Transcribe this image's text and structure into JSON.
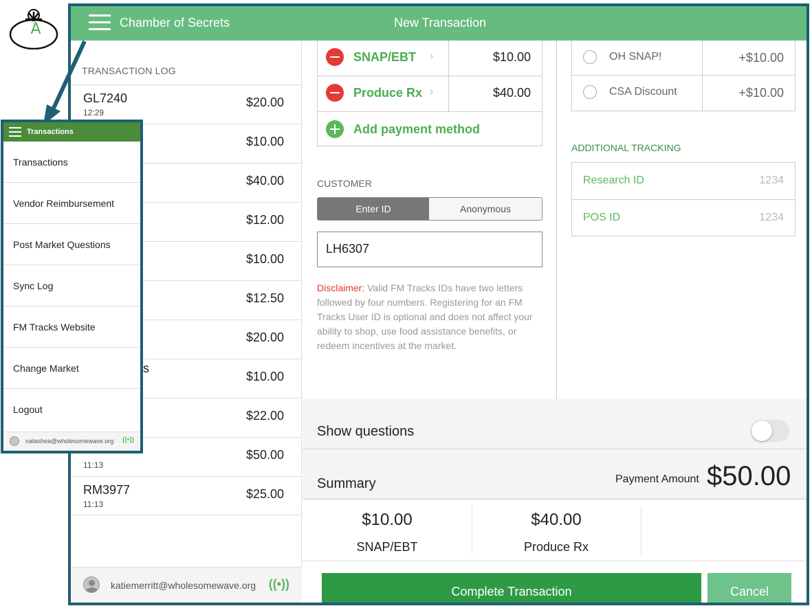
{
  "badge_letter": "A",
  "header": {
    "app_title": "Chamber of Secrets",
    "page_title": "New Transaction"
  },
  "log": {
    "heading": "TRANSACTION LOG",
    "rows": [
      {
        "id": "GL7240",
        "time": "12:29",
        "amount": "$20.00"
      },
      {
        "id": "",
        "time": "",
        "amount": "$10.00"
      },
      {
        "id": "",
        "time": "",
        "amount": "$40.00"
      },
      {
        "id": "",
        "time": "",
        "amount": "$12.00"
      },
      {
        "id": "",
        "time": "",
        "amount": "$10.00"
      },
      {
        "id": "",
        "time": "",
        "amount": "$12.50"
      },
      {
        "id": "",
        "time": "",
        "amount": "$20.00"
      },
      {
        "id": "",
        "time": "",
        "amount": "$10.00"
      },
      {
        "id": "",
        "time": "",
        "amount": "$22.00"
      },
      {
        "id": "",
        "time": "11:13",
        "amount": "$50.00"
      },
      {
        "id": "RM3977",
        "time": "11:13",
        "amount": "$25.00"
      }
    ],
    "partial_text": "s",
    "footer_email": "katiemerritt@wholesomewave.org",
    "wifi_icon": "((•))"
  },
  "payments": [
    {
      "name": "SNAP/EBT",
      "amount": "$10.00"
    },
    {
      "name": "Produce Rx",
      "amount": "$40.00"
    }
  ],
  "chevron": "›",
  "add_payment": "Add payment method",
  "customer": {
    "heading": "CUSTOMER",
    "seg_enter": "Enter ID",
    "seg_anon": "Anonymous",
    "id_value": "LH6307",
    "disclaimer_label": "Disclaimer:",
    "disclaimer_text": " Valid FM Tracks IDs have two letters followed by four numbers. Registering for an FM Tracks User ID is optional and does not affect your ability to shop, use food assistance benefits, or redeem incentives at the market."
  },
  "incentives": [
    {
      "name": "OH SNAP!",
      "amount": "+$10.00"
    },
    {
      "name": "CSA Discount",
      "amount": "+$10.00"
    }
  ],
  "tracking": {
    "heading": "ADDITIONAL TRACKING",
    "fields": [
      {
        "name": "Research ID",
        "placeholder": "1234"
      },
      {
        "name": "POS ID",
        "placeholder": "1234"
      }
    ]
  },
  "questions": {
    "label": "Show questions",
    "enabled": false
  },
  "summary": {
    "label": "Summary",
    "payment_amount_label": "Payment Amount",
    "payment_amount": "$50.00",
    "totals": [
      {
        "value": "$10.00",
        "name": "SNAP/EBT"
      },
      {
        "value": "$40.00",
        "name": "Produce Rx"
      }
    ]
  },
  "buttons": {
    "complete": "Complete Transaction",
    "cancel": "Cancel"
  },
  "menu": {
    "title": "Transactions",
    "items": [
      "Transactions",
      "Vendor Reimbursement",
      "Post Market Questions",
      "Sync Log",
      "FM Tracks Website",
      "Change Market",
      "Logout"
    ],
    "footer_email": "natashea@wholesomewave.org",
    "wifi_icon": "((•))"
  },
  "colors": {
    "brand_green": "#66bb7f",
    "frame": "#1f5f74",
    "danger": "#e53935",
    "complete": "#2e9a44"
  }
}
